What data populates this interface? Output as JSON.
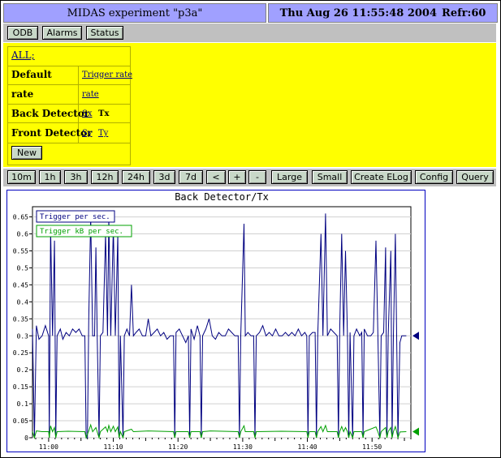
{
  "header": {
    "title": "MIDAS experiment \"p3a\"",
    "datetime": "Thu Aug 26 11:55:48 2004",
    "refresh": "Refr:60"
  },
  "nav": {
    "odb": "ODB",
    "alarms": "Alarms",
    "status": "Status"
  },
  "groups": {
    "all": "ALL;",
    "rows": [
      {
        "label": "Default",
        "links": [
          "Trigger rate"
        ]
      },
      {
        "label": "rate",
        "links": [
          "rate"
        ]
      },
      {
        "label": "Back Detector",
        "links": [
          "Sx",
          "Tx"
        ]
      },
      {
        "label": "Front Detector",
        "links": [
          "Sy",
          "Ty"
        ]
      }
    ],
    "new_label": "New"
  },
  "toolbar": {
    "time_buttons": [
      "10m",
      "1h",
      "3h",
      "12h",
      "24h",
      "3d",
      "7d",
      "<",
      "+",
      "-"
    ],
    "action_buttons": [
      "Large",
      "Small",
      "Create ELog",
      "Config",
      "Query"
    ]
  },
  "colors": {
    "title_bg": "#a0a0ff",
    "panel_bg": "#ffff00",
    "trigger_per_sec": "#000080",
    "trigger_kb_per_sec": "#00a000"
  },
  "chart_data": {
    "type": "line",
    "title": "Back Detector/Tx",
    "xlabel": "",
    "ylabel": "",
    "x_ticks": [
      "11:00",
      "11:10",
      "11:20",
      "11:30",
      "11:40",
      "11:50"
    ],
    "y_ticks": [
      "0",
      "0.05",
      "0.1",
      "0.15",
      "0.2",
      "0.25",
      "0.3",
      "0.35",
      "0.4",
      "0.45",
      "0.5",
      "0.55",
      "0.6",
      "0.65"
    ],
    "ylim": [
      0,
      0.68
    ],
    "xlim_minutes": [
      -2.5,
      56
    ],
    "grid": true,
    "legend_position": "top-left",
    "series": [
      {
        "name": "Trigger per sec.",
        "points": [
          [
            -2.5,
            0.32
          ],
          [
            -2.2,
            0.0
          ],
          [
            -1.9,
            0.33
          ],
          [
            -1.5,
            0.29
          ],
          [
            -1.0,
            0.3
          ],
          [
            -0.5,
            0.33
          ],
          [
            0.0,
            0.3
          ],
          [
            0.1,
            0.0
          ],
          [
            0.3,
            0.62
          ],
          [
            0.6,
            0.3
          ],
          [
            0.9,
            0.58
          ],
          [
            1.1,
            0.0
          ],
          [
            1.3,
            0.3
          ],
          [
            1.8,
            0.32
          ],
          [
            2.2,
            0.29
          ],
          [
            2.7,
            0.31
          ],
          [
            3.2,
            0.3
          ],
          [
            3.7,
            0.32
          ],
          [
            4.2,
            0.31
          ],
          [
            4.7,
            0.32
          ],
          [
            5.2,
            0.3
          ],
          [
            5.6,
            0.3
          ],
          [
            5.8,
            0.0
          ],
          [
            6.0,
            0.0
          ],
          [
            6.2,
            0.35
          ],
          [
            6.5,
            0.65
          ],
          [
            6.8,
            0.3
          ],
          [
            7.1,
            0.3
          ],
          [
            7.3,
            0.56
          ],
          [
            7.5,
            0.3
          ],
          [
            7.8,
            0.0
          ],
          [
            8.0,
            0.3
          ],
          [
            8.4,
            0.31
          ],
          [
            8.8,
            0.6
          ],
          [
            9.1,
            0.3
          ],
          [
            9.3,
            0.65
          ],
          [
            9.6,
            0.3
          ],
          [
            10.0,
            0.62
          ],
          [
            10.3,
            0.3
          ],
          [
            10.7,
            0.6
          ],
          [
            10.9,
            0.0
          ],
          [
            11.1,
            0.3
          ],
          [
            11.5,
            0.0
          ],
          [
            11.7,
            0.3
          ],
          [
            12.1,
            0.32
          ],
          [
            12.5,
            0.3
          ],
          [
            12.8,
            0.45
          ],
          [
            13.1,
            0.3
          ],
          [
            13.5,
            0.31
          ],
          [
            14.0,
            0.32
          ],
          [
            14.5,
            0.3
          ],
          [
            15.0,
            0.3
          ],
          [
            15.4,
            0.35
          ],
          [
            15.8,
            0.3
          ],
          [
            16.3,
            0.31
          ],
          [
            16.8,
            0.32
          ],
          [
            17.3,
            0.3
          ],
          [
            17.8,
            0.31
          ],
          [
            18.3,
            0.29
          ],
          [
            18.8,
            0.3
          ],
          [
            19.3,
            0.3
          ],
          [
            19.5,
            0.0
          ],
          [
            19.7,
            0.31
          ],
          [
            20.2,
            0.32
          ],
          [
            20.7,
            0.3
          ],
          [
            21.2,
            0.28
          ],
          [
            21.6,
            0.3
          ],
          [
            21.8,
            0.0
          ],
          [
            22.0,
            0.32
          ],
          [
            22.5,
            0.29
          ],
          [
            23.0,
            0.33
          ],
          [
            23.4,
            0.3
          ],
          [
            23.6,
            0.0
          ],
          [
            23.8,
            0.3
          ],
          [
            24.3,
            0.32
          ],
          [
            24.8,
            0.35
          ],
          [
            25.3,
            0.3
          ],
          [
            25.8,
            0.29
          ],
          [
            26.3,
            0.31
          ],
          [
            26.8,
            0.3
          ],
          [
            27.3,
            0.3
          ],
          [
            27.8,
            0.32
          ],
          [
            28.3,
            0.31
          ],
          [
            28.8,
            0.3
          ],
          [
            29.3,
            0.3
          ],
          [
            29.5,
            0.0
          ],
          [
            29.7,
            0.3
          ],
          [
            30.2,
            0.63
          ],
          [
            30.4,
            0.3
          ],
          [
            30.8,
            0.31
          ],
          [
            31.3,
            0.3
          ],
          [
            31.7,
            0.3
          ],
          [
            31.9,
            0.0
          ],
          [
            32.1,
            0.3
          ],
          [
            32.6,
            0.31
          ],
          [
            33.1,
            0.33
          ],
          [
            33.6,
            0.3
          ],
          [
            34.1,
            0.31
          ],
          [
            34.6,
            0.3
          ],
          [
            35.1,
            0.32
          ],
          [
            35.6,
            0.3
          ],
          [
            36.1,
            0.3
          ],
          [
            36.6,
            0.31
          ],
          [
            37.1,
            0.3
          ],
          [
            37.6,
            0.31
          ],
          [
            38.1,
            0.3
          ],
          [
            38.6,
            0.32
          ],
          [
            39.1,
            0.3
          ],
          [
            39.6,
            0.31
          ],
          [
            39.9,
            0.3
          ],
          [
            40.1,
            0.0
          ],
          [
            40.3,
            0.3
          ],
          [
            40.8,
            0.31
          ],
          [
            41.2,
            0.31
          ],
          [
            41.4,
            0.0
          ],
          [
            41.6,
            0.3
          ],
          [
            42.1,
            0.6
          ],
          [
            42.4,
            0.3
          ],
          [
            42.8,
            0.66
          ],
          [
            43.1,
            0.3
          ],
          [
            43.6,
            0.32
          ],
          [
            44.1,
            0.31
          ],
          [
            44.6,
            0.3
          ],
          [
            44.8,
            0.0
          ],
          [
            45.0,
            0.32
          ],
          [
            45.3,
            0.6
          ],
          [
            45.6,
            0.3
          ],
          [
            45.9,
            0.55
          ],
          [
            46.2,
            0.3
          ],
          [
            46.4,
            0.0
          ],
          [
            46.6,
            0.31
          ],
          [
            47.0,
            0.0
          ],
          [
            47.2,
            0.3
          ],
          [
            47.6,
            0.32
          ],
          [
            48.1,
            0.3
          ],
          [
            48.4,
            0.31
          ],
          [
            48.6,
            0.0
          ],
          [
            48.8,
            0.32
          ],
          [
            49.3,
            0.3
          ],
          [
            49.8,
            0.3
          ],
          [
            50.2,
            0.31
          ],
          [
            50.6,
            0.58
          ],
          [
            50.9,
            0.3
          ],
          [
            51.2,
            0.0
          ],
          [
            51.4,
            0.3
          ],
          [
            51.8,
            0.31
          ],
          [
            52.1,
            0.56
          ],
          [
            52.3,
            0.0
          ],
          [
            52.5,
            0.3
          ],
          [
            52.9,
            0.55
          ],
          [
            53.1,
            0.0
          ],
          [
            53.3,
            0.3
          ],
          [
            53.6,
            0.6
          ],
          [
            53.8,
            0.3
          ],
          [
            54.0,
            0.0
          ],
          [
            54.3,
            0.28
          ],
          [
            54.6,
            0.3
          ],
          [
            55.0,
            0.3
          ],
          [
            55.3,
            0.3
          ]
        ]
      },
      {
        "name": "Trigger kB per sec.",
        "points": [
          [
            -2.5,
            0.018
          ],
          [
            -2.2,
            0.0
          ],
          [
            -1.9,
            0.02
          ],
          [
            -1.0,
            0.018
          ],
          [
            0.0,
            0.018
          ],
          [
            0.1,
            0.0
          ],
          [
            0.3,
            0.035
          ],
          [
            0.6,
            0.018
          ],
          [
            0.9,
            0.03
          ],
          [
            1.1,
            0.0
          ],
          [
            1.3,
            0.018
          ],
          [
            3.0,
            0.019
          ],
          [
            5.6,
            0.018
          ],
          [
            5.8,
            0.0
          ],
          [
            6.2,
            0.02
          ],
          [
            6.5,
            0.038
          ],
          [
            6.8,
            0.018
          ],
          [
            7.3,
            0.03
          ],
          [
            7.8,
            0.0
          ],
          [
            8.0,
            0.018
          ],
          [
            8.8,
            0.032
          ],
          [
            9.1,
            0.018
          ],
          [
            9.3,
            0.036
          ],
          [
            9.6,
            0.018
          ],
          [
            10.0,
            0.034
          ],
          [
            10.3,
            0.018
          ],
          [
            10.7,
            0.032
          ],
          [
            10.9,
            0.0
          ],
          [
            11.1,
            0.018
          ],
          [
            11.5,
            0.0
          ],
          [
            11.7,
            0.018
          ],
          [
            12.8,
            0.025
          ],
          [
            13.1,
            0.018
          ],
          [
            15.4,
            0.02
          ],
          [
            19.3,
            0.018
          ],
          [
            19.5,
            0.0
          ],
          [
            19.7,
            0.018
          ],
          [
            21.6,
            0.018
          ],
          [
            21.8,
            0.0
          ],
          [
            22.0,
            0.018
          ],
          [
            23.4,
            0.018
          ],
          [
            23.6,
            0.0
          ],
          [
            23.8,
            0.018
          ],
          [
            25.0,
            0.02
          ],
          [
            29.3,
            0.018
          ],
          [
            29.5,
            0.0
          ],
          [
            29.7,
            0.018
          ],
          [
            30.2,
            0.035
          ],
          [
            30.4,
            0.018
          ],
          [
            31.7,
            0.018
          ],
          [
            31.9,
            0.0
          ],
          [
            32.1,
            0.018
          ],
          [
            36.0,
            0.019
          ],
          [
            39.9,
            0.018
          ],
          [
            40.1,
            0.0
          ],
          [
            40.3,
            0.018
          ],
          [
            41.2,
            0.018
          ],
          [
            41.4,
            0.0
          ],
          [
            41.6,
            0.018
          ],
          [
            42.1,
            0.033
          ],
          [
            42.4,
            0.018
          ],
          [
            42.8,
            0.036
          ],
          [
            43.1,
            0.018
          ],
          [
            44.6,
            0.018
          ],
          [
            44.8,
            0.0
          ],
          [
            45.0,
            0.018
          ],
          [
            45.3,
            0.033
          ],
          [
            45.6,
            0.018
          ],
          [
            45.9,
            0.03
          ],
          [
            46.2,
            0.018
          ],
          [
            46.4,
            0.0
          ],
          [
            46.6,
            0.018
          ],
          [
            47.0,
            0.0
          ],
          [
            47.2,
            0.018
          ],
          [
            48.4,
            0.018
          ],
          [
            48.6,
            0.0
          ],
          [
            48.8,
            0.018
          ],
          [
            50.6,
            0.032
          ],
          [
            50.9,
            0.018
          ],
          [
            51.2,
            0.0
          ],
          [
            51.4,
            0.018
          ],
          [
            52.1,
            0.03
          ],
          [
            52.3,
            0.0
          ],
          [
            52.5,
            0.018
          ],
          [
            52.9,
            0.03
          ],
          [
            53.1,
            0.0
          ],
          [
            53.3,
            0.018
          ],
          [
            53.6,
            0.033
          ],
          [
            53.8,
            0.018
          ],
          [
            54.0,
            0.0
          ],
          [
            54.3,
            0.017
          ],
          [
            55.3,
            0.018
          ]
        ]
      }
    ]
  }
}
